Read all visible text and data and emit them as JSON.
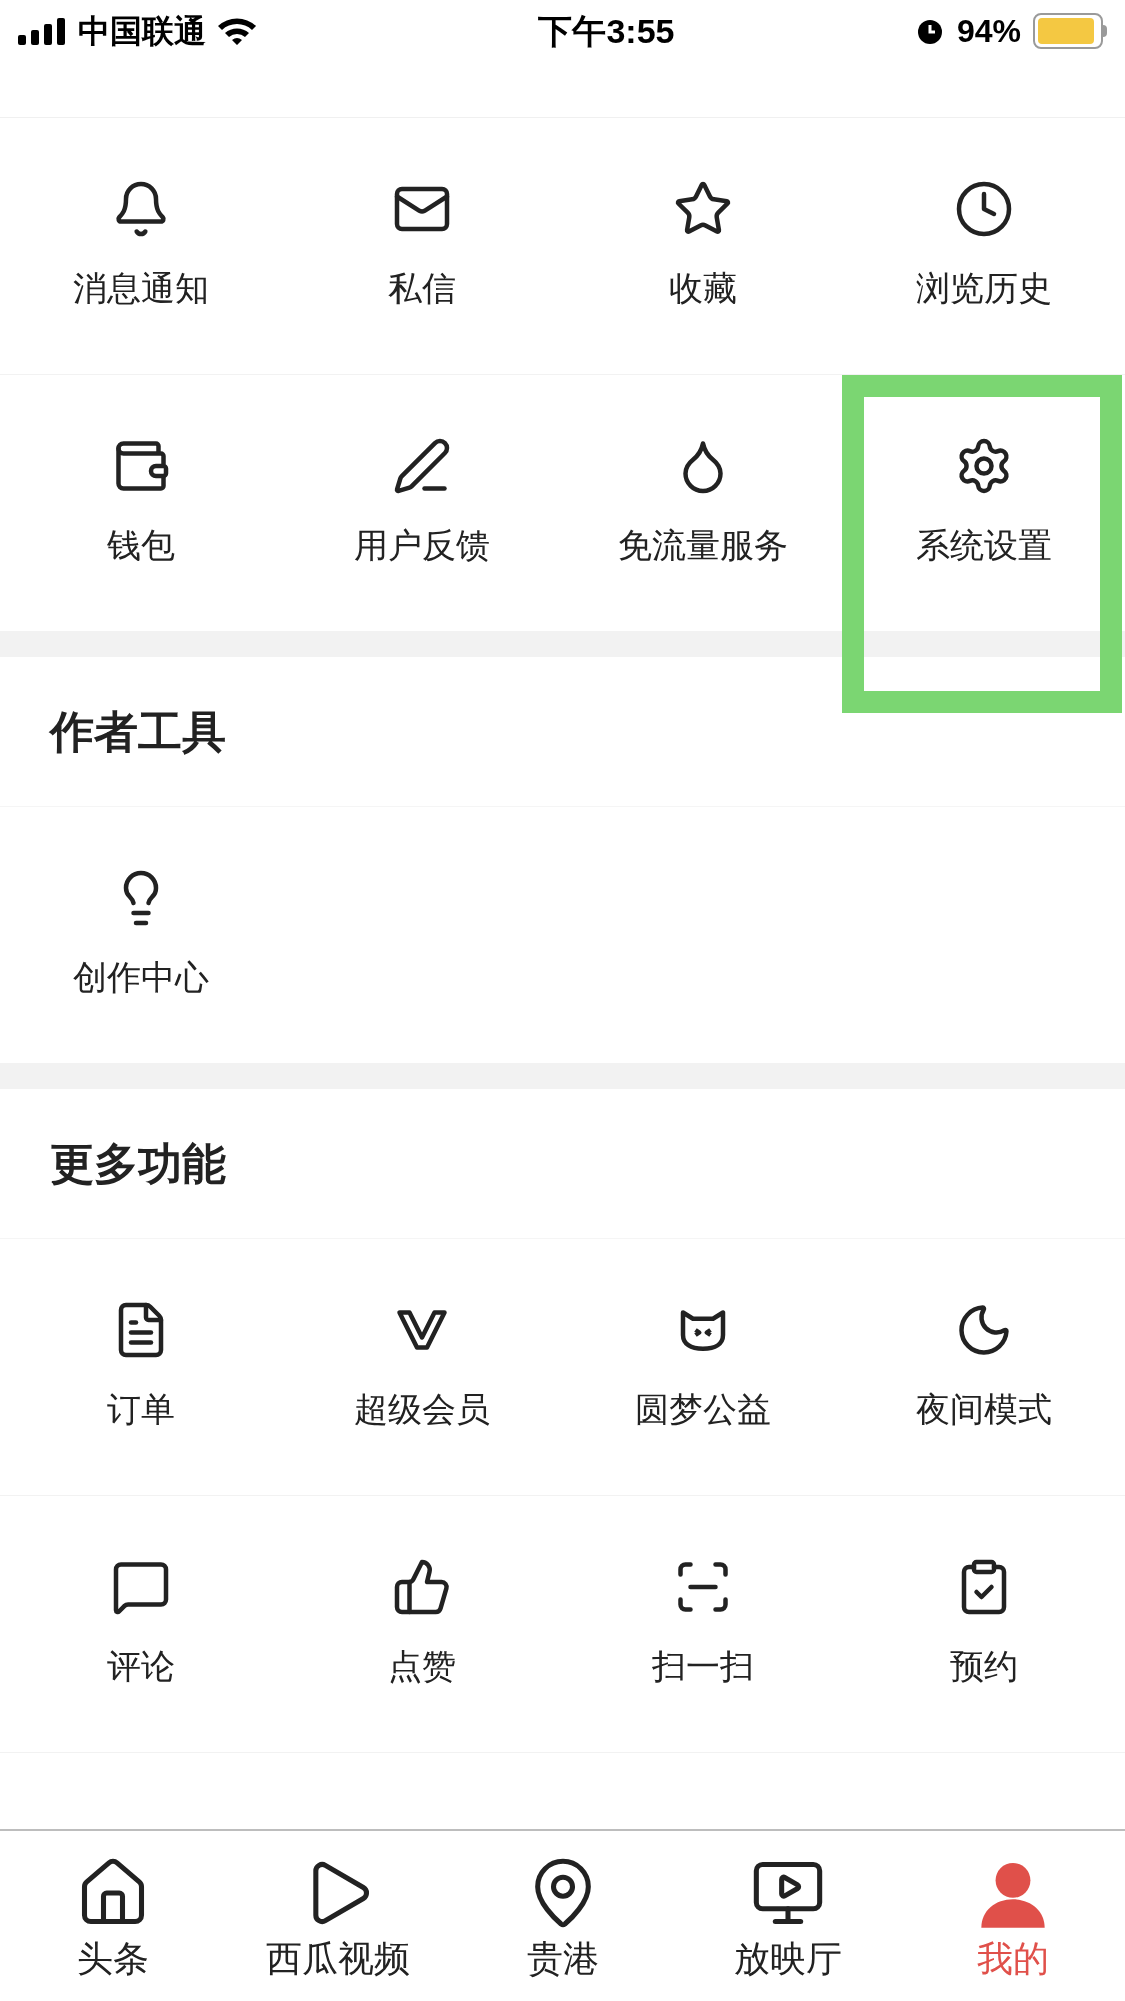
{
  "status_bar": {
    "carrier": "中国联通",
    "time": "下午3:55",
    "battery": "94%"
  },
  "sections": [
    {
      "rows": [
        [
          {
            "label": "消息通知",
            "kind": "bell"
          },
          {
            "label": "私信",
            "kind": "mail"
          },
          {
            "label": "收藏",
            "kind": "star"
          },
          {
            "label": "浏览历史",
            "kind": "clock"
          }
        ],
        [
          {
            "label": "钱包",
            "kind": "wallet"
          },
          {
            "label": "用户反馈",
            "kind": "pen"
          },
          {
            "label": "免流量服务",
            "kind": "drop"
          },
          {
            "label": "系统设置",
            "kind": "gear",
            "highlighted": true
          }
        ]
      ]
    },
    {
      "title": "作者工具",
      "rows": [
        [
          {
            "label": "创作中心",
            "kind": "bulb"
          }
        ]
      ]
    },
    {
      "title": "更多功能",
      "rows": [
        [
          {
            "label": "订单",
            "kind": "file"
          },
          {
            "label": "超级会员",
            "kind": "vip"
          },
          {
            "label": "圆梦公益",
            "kind": "cat"
          },
          {
            "label": "夜间模式",
            "kind": "moon"
          }
        ],
        [
          {
            "label": "评论",
            "kind": "comment"
          },
          {
            "label": "点赞",
            "kind": "thumb"
          },
          {
            "label": "扫一扫",
            "kind": "scan"
          },
          {
            "label": "预约",
            "kind": "clipboard"
          }
        ]
      ]
    }
  ],
  "tab_bar": [
    {
      "label": "头条",
      "kind": "home",
      "selected": false
    },
    {
      "label": "西瓜视频",
      "kind": "play",
      "selected": false
    },
    {
      "label": "贵港",
      "kind": "pin",
      "selected": false
    },
    {
      "label": "放映厅",
      "kind": "tv",
      "selected": false
    },
    {
      "label": "我的",
      "kind": "user",
      "selected": true
    }
  ]
}
